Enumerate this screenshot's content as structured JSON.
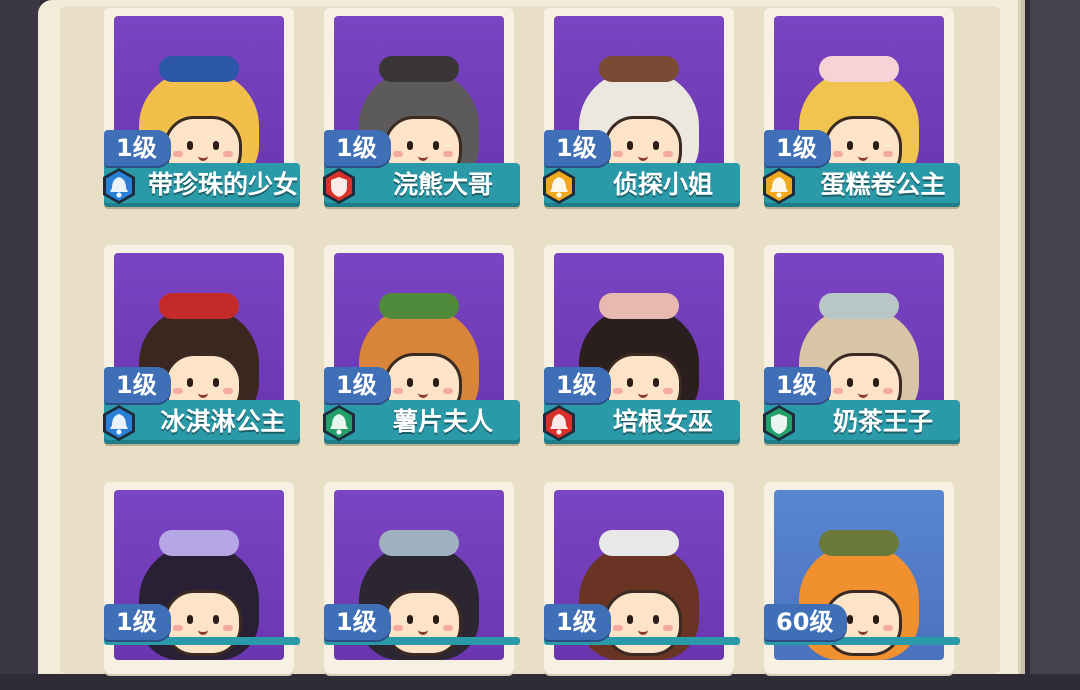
{
  "cards": [
    {
      "level": "1级",
      "name": "带珍珠的少女",
      "badge_color": "#2a7fd6",
      "badge_icon": "bell-icon",
      "bg": "purple",
      "hair": "#f2c04a",
      "accent": "#2c57a8"
    },
    {
      "level": "1级",
      "name": "浣熊大哥",
      "badge_color": "#d9302a",
      "badge_icon": "shield-icon",
      "bg": "purple",
      "hair": "#5d5a5c",
      "accent": "#3a3637"
    },
    {
      "level": "1级",
      "name": "侦探小姐",
      "badge_color": "#f0a81c",
      "badge_icon": "bell-icon",
      "bg": "purple",
      "hair": "#ece7df",
      "accent": "#7b4a34"
    },
    {
      "level": "1级",
      "name": "蛋糕卷公主",
      "badge_color": "#f0a81c",
      "badge_icon": "bell-icon",
      "bg": "purple",
      "hair": "#f0c44e",
      "accent": "#f7d2d6"
    },
    {
      "level": "1级",
      "name": "冰淇淋公主",
      "badge_color": "#2a7fd6",
      "badge_icon": "bell-icon",
      "bg": "purple",
      "hair": "#3c2620",
      "accent": "#c42a2a"
    },
    {
      "level": "1级",
      "name": "薯片夫人",
      "badge_color": "#22a06a",
      "badge_icon": "bell-icon",
      "bg": "purple",
      "hair": "#d8853a",
      "accent": "#4f8a3a"
    },
    {
      "level": "1级",
      "name": "培根女巫",
      "badge_color": "#d9302a",
      "badge_icon": "bell-icon",
      "bg": "purple",
      "hair": "#2b1e1e",
      "accent": "#e7b9b0"
    },
    {
      "level": "1级",
      "name": "奶茶王子",
      "badge_color": "#22a06a",
      "badge_icon": "shield-icon",
      "bg": "purple",
      "hair": "#d8c6a6",
      "accent": "#b8c6c8"
    },
    {
      "level": "1级",
      "name": "",
      "badge_color": "",
      "badge_icon": "",
      "bg": "purple",
      "hair": "#2a2036",
      "accent": "#b7a6e6"
    },
    {
      "level": "1级",
      "name": "",
      "badge_color": "",
      "badge_icon": "",
      "bg": "purple",
      "hair": "#2c2633",
      "accent": "#9fb0c0"
    },
    {
      "level": "1级",
      "name": "",
      "badge_color": "",
      "badge_icon": "",
      "bg": "purple",
      "hair": "#6a3424",
      "accent": "#e8e8e8"
    },
    {
      "level": "60级",
      "name": "",
      "badge_color": "",
      "badge_icon": "",
      "bg": "blue",
      "hair": "#f0902e",
      "accent": "#6b7a3a"
    }
  ]
}
